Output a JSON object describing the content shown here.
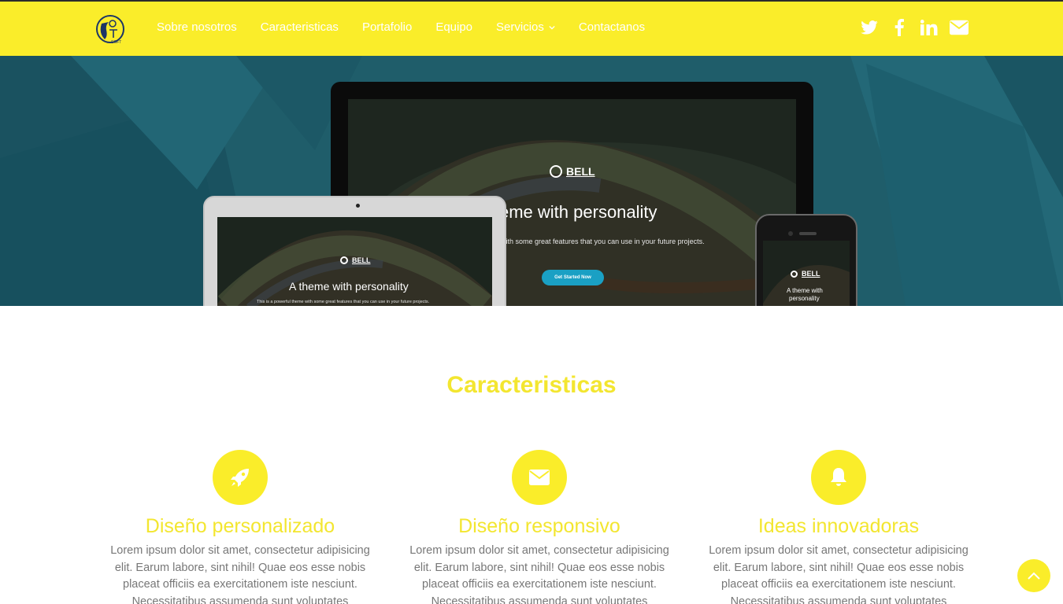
{
  "nav": {
    "links": [
      "Sobre nosotros",
      "Caracteristicas",
      "Portafolio",
      "Equipo",
      "Servicios",
      "Contactanos"
    ],
    "social_icons": [
      "twitter-icon",
      "facebook-icon",
      "linkedin-icon",
      "envelope-icon"
    ]
  },
  "hero": {
    "monitor": {
      "brand": "BELL",
      "title": "eme with personality",
      "subtitle": "vith some great features that you can use in your future projects.",
      "button": "Get Started Now"
    },
    "laptop": {
      "brand": "BELL",
      "title": "A theme with personality",
      "subtitle": "This is a powerful theme with some great features that you can use in your future projects."
    },
    "phone": {
      "brand": "BELL",
      "title_line1": "A theme with",
      "title_line2": "personality"
    }
  },
  "features": {
    "title": "Caracteristicas",
    "items": [
      {
        "icon": "rocket-icon",
        "title": "Diseño personalizado",
        "text": "Lorem ipsum dolor sit amet, consectetur adipisicing elit. Earum labore, sint nihil! Quae eos esse nobis placeat officiis ea exercitationem iste nesciunt. Necessitatibus assumenda sunt voluptates cumque"
      },
      {
        "icon": "envelope-icon",
        "title": "Diseño responsivo",
        "text": "Lorem ipsum dolor sit amet, consectetur adipisicing elit. Earum labore, sint nihil! Quae eos esse nobis placeat officiis ea exercitationem iste nesciunt. Necessitatibus assumenda sunt voluptates cumque"
      },
      {
        "icon": "bell-icon",
        "title": "Ideas innovadoras",
        "text": "Lorem ipsum dolor sit amet, consectetur adipisicing elit. Earum labore, sint nihil! Quae eos esse nobis placeat officiis ea exercitationem iste nesciunt. Necessitatibus assumenda sunt voluptates cumque"
      }
    ]
  },
  "colors": {
    "brand_yellow": "#faed2a",
    "heading_yellow": "#f3e630",
    "hero_teal": "#1e5f6c",
    "text_gray": "#777777"
  }
}
